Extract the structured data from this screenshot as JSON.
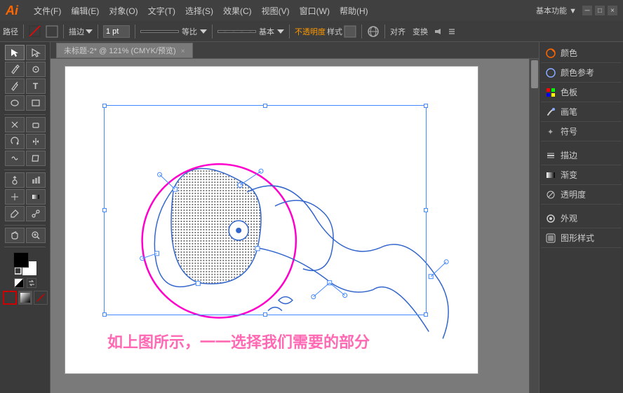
{
  "app": {
    "logo": "Ai",
    "title": "基本功能",
    "workspace_label": "基本功能 ▼"
  },
  "menubar": {
    "items": [
      "文件(F)",
      "编辑(E)",
      "对象(O)",
      "文字(T)",
      "选择(S)",
      "效果(C)",
      "视图(V)",
      "窗口(W)",
      "帮助(H)"
    ]
  },
  "toolbar": {
    "path_label": "路径",
    "stroke_width": "1 pt",
    "ratio_label": "等比",
    "basic_label": "基本",
    "opacity_label": "不透明度",
    "style_label": "样式",
    "align_label": "对齐",
    "transform_label": "变换"
  },
  "tab": {
    "title": "未标题-2* @ 121% (CMYK/预览)",
    "close": "×"
  },
  "caption": {
    "text": "如上图所示，一一选择我们需要的部分"
  },
  "right_panel": {
    "items": [
      {
        "icon": "color-icon",
        "label": "颜色"
      },
      {
        "icon": "color-ref-icon",
        "label": "颜色参考"
      },
      {
        "icon": "swatches-icon",
        "label": "色板"
      },
      {
        "icon": "brush-icon",
        "label": "画笔"
      },
      {
        "icon": "symbol-icon",
        "label": "符号"
      },
      {
        "icon": "stroke-icon",
        "label": "描边"
      },
      {
        "icon": "gradient-icon",
        "label": "渐变"
      },
      {
        "icon": "opacity-icon",
        "label": "透明度"
      },
      {
        "icon": "appearance-icon",
        "label": "外观"
      },
      {
        "icon": "graphic-style-icon",
        "label": "图形样式"
      }
    ]
  },
  "tools": {
    "rows": [
      [
        "▶",
        "▷"
      ],
      [
        "✎",
        "✤"
      ],
      [
        "✏",
        "T"
      ],
      [
        "⬭",
        "◻"
      ],
      [
        "✄",
        "⟋"
      ],
      [
        "⊕",
        "✦"
      ],
      [
        "⊘",
        "⊗"
      ],
      [
        "⌖",
        "⌗"
      ],
      [
        "⊞",
        "⊟"
      ],
      [
        "↔",
        "⇌"
      ],
      [
        "⬜",
        "▦"
      ],
      [
        "⬛",
        "▤"
      ],
      [
        "✋",
        "🔍"
      ]
    ]
  }
}
